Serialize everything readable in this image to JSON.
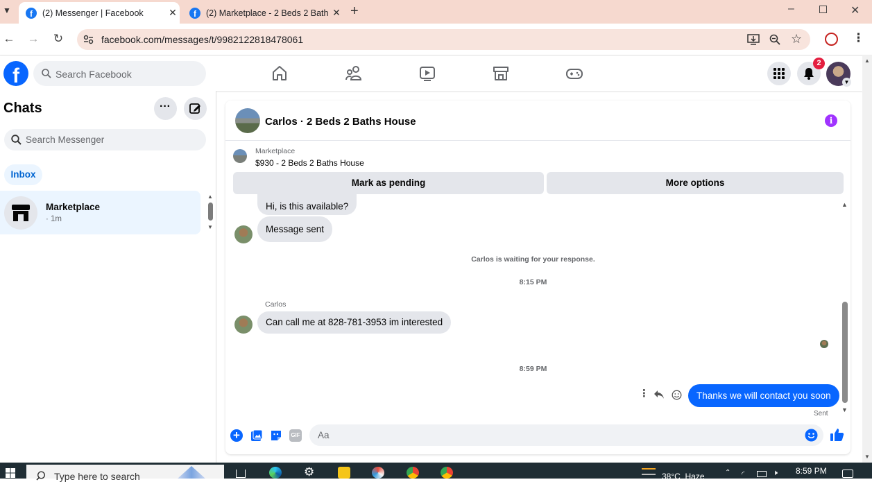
{
  "browser": {
    "tabs": [
      {
        "title": "(2) Messenger | Facebook",
        "active": true
      },
      {
        "title": "(2) Marketplace - 2 Beds 2 Bath",
        "active": false
      }
    ],
    "url": "facebook.com/messages/t/9982122818478061"
  },
  "fb": {
    "search_placeholder": "Search Facebook",
    "notifications_count": "2"
  },
  "sidebar": {
    "title": "Chats",
    "search_placeholder": "Search Messenger",
    "filter": "Inbox",
    "conversations": [
      {
        "name": "Marketplace",
        "time": "· 1m"
      }
    ]
  },
  "chat": {
    "title": "Carlos · 2 Beds 2 Baths House",
    "listing_source": "Marketplace",
    "listing_item": "$930 - 2 Beds 2 Baths House",
    "mark_pending_label": "Mark as pending",
    "more_options_label": "More options",
    "messages": {
      "m1": "Hi, is this available?",
      "m2": "Message sent",
      "waiting_note": "Carlos is waiting for your response.",
      "time1": "8:15 PM",
      "sender": "Carlos",
      "m3": "Can call me at 828-781-3953 im interested",
      "time2": "8:59 PM",
      "m4": "Thanks we will contact you soon",
      "status": "Sent"
    },
    "composer_placeholder": "Aa"
  },
  "taskbar": {
    "search_placeholder": "Type here to search",
    "weather": "38°C  Haze",
    "clock": "8:59 PM"
  },
  "colors": {
    "accent": "#0866ff",
    "tab_strip": "#f6d9cf",
    "badge": "#e41e3f"
  }
}
